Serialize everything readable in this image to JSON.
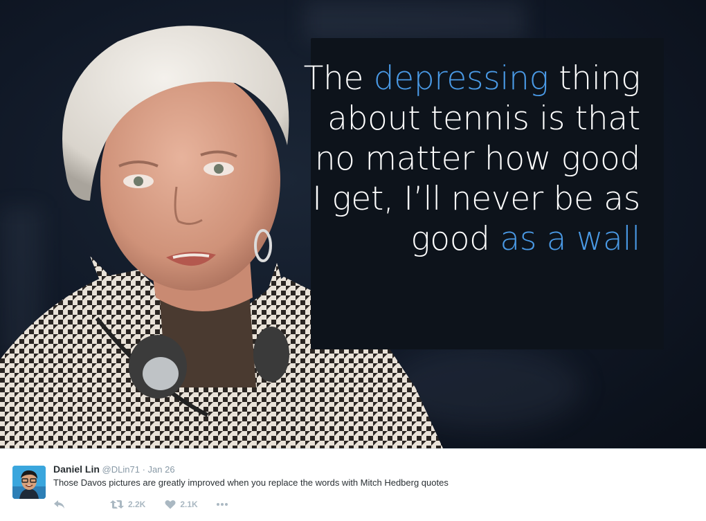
{
  "quote": {
    "segments": [
      {
        "text": "The ",
        "highlight": false
      },
      {
        "text": "depressing",
        "highlight": true
      },
      {
        "text": " thing about tennis is that no matter how good I get, I’ll never be as good ",
        "highlight": false
      },
      {
        "text": "as a wall",
        "highlight": true
      }
    ],
    "text_color": "#ffffff",
    "highlight_color": "#4a9ae6"
  },
  "tweet": {
    "author_name": "Daniel Lin",
    "handle": "@DLin71",
    "separator": "·",
    "date": "Jan 26",
    "text": "Those Davos pictures are greatly improved when you replace the words with Mitch Hedberg quotes",
    "actions": {
      "reply_icon": "reply-icon",
      "retweet_icon": "retweet-icon",
      "retweet_count": "2.2K",
      "like_icon": "heart-icon",
      "like_count": "2.1K",
      "more_icon": "more-dots-icon"
    }
  }
}
